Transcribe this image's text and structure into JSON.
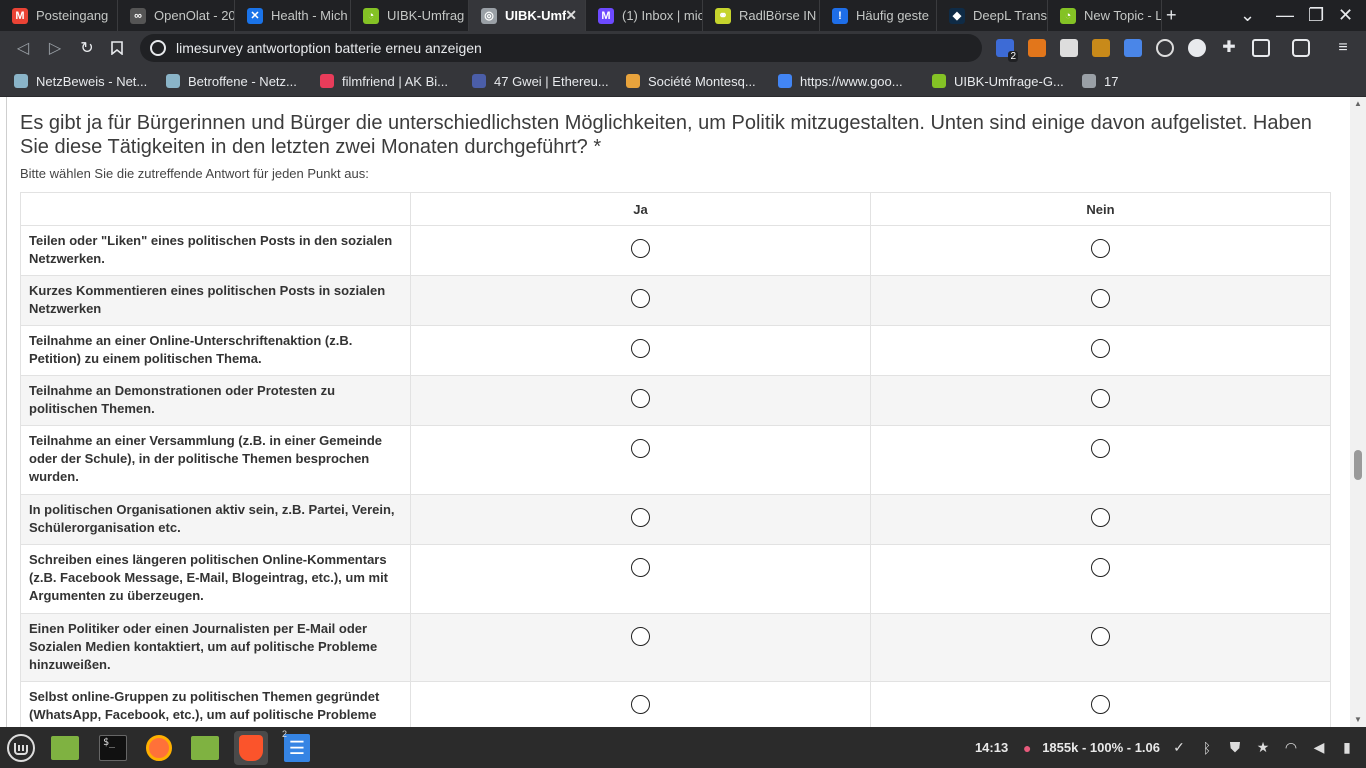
{
  "tabs": [
    {
      "label": "Posteingang",
      "icon": "gmail-icon",
      "color": "#ea4335",
      "glyph": "M"
    },
    {
      "label": "OpenOlat - 20",
      "icon": "openolat-icon",
      "color": "#555555",
      "glyph": "∞"
    },
    {
      "label": "Health - Mich",
      "icon": "health-icon",
      "color": "#1a73e8",
      "glyph": "✕"
    },
    {
      "label": "UIBK-Umfrag",
      "icon": "limesurvey-icon",
      "color": "#84c225",
      "glyph": "◔"
    },
    {
      "label": "UIBK-Umf",
      "icon": "globe-icon",
      "color": "#9aa0a6",
      "glyph": "◎",
      "active": true
    },
    {
      "label": "(1) Inbox | mic",
      "icon": "proton-mail-icon",
      "color": "#6d4aff",
      "glyph": "M"
    },
    {
      "label": "RadlBörse IN",
      "icon": "bike-icon",
      "color": "#c6d42d",
      "glyph": "⚭"
    },
    {
      "label": "Häufig geste",
      "icon": "faq-icon",
      "color": "#1e6ee8",
      "glyph": "!"
    },
    {
      "label": "DeepL Transl",
      "icon": "deepl-icon",
      "color": "#0f2b46",
      "glyph": "◆"
    },
    {
      "label": "New Topic - L",
      "icon": "limesurvey-icon",
      "color": "#84c225",
      "glyph": "◔"
    }
  ],
  "omnibox": {
    "text": "limesurvey antwortoption batterie erneu anzeigen"
  },
  "extensions": {
    "badge": "2"
  },
  "bookmarks": [
    {
      "label": "NetzBeweis - Net...",
      "icon": "netzbeweis-icon",
      "color": "#8ab4c8"
    },
    {
      "label": "Betroffene - Netz...",
      "icon": "netzbeweis-icon",
      "color": "#8ab4c8"
    },
    {
      "label": "filmfriend | AK Bi...",
      "icon": "filmfriend-icon",
      "color": "#e83c5a"
    },
    {
      "label": "47 Gwei | Ethereu...",
      "icon": "ethereum-icon",
      "color": "#4b5ea8"
    },
    {
      "label": "Société Montesq...",
      "icon": "montesquieu-icon",
      "color": "#e8a33c"
    },
    {
      "label": "https://www.goo...",
      "icon": "google-icon",
      "color": "#4285f4"
    },
    {
      "label": "UIBK-Umfrage-G...",
      "icon": "limesurvey-icon",
      "color": "#84c225"
    },
    {
      "label": "17",
      "icon": "globe-icon",
      "color": "#9aa0a6"
    }
  ],
  "question": {
    "text": "Es gibt ja für Bürgerinnen und Bürger die unterschiedlichsten Möglichkeiten, um Politik mitzugestalten. Unten sind einige davon aufgelistet. Haben Sie diese Tätigkeiten in den letzten zwei Monaten durchgeführt? *",
    "help": "Bitte wählen Sie die zutreffende Antwort für jeden Punkt aus:"
  },
  "grid": {
    "columns": [
      "Ja",
      "Nein"
    ],
    "rows": [
      "Teilen oder \"Liken\" eines politischen Posts in den sozialen Netzwerken.",
      "Kurzes Kommentieren eines politischen Posts in sozialen Netzwerken",
      "Teilnahme an einer Online-Unterschriftenaktion (z.B. Petition) zu einem politischen Thema.",
      "Teilnahme an Demonstrationen oder Protesten zu politischen Themen.",
      "Teilnahme an einer Versammlung (z.B. in einer Gemeinde oder der Schule), in der politische Themen besprochen wurden.",
      "In politischen Organisationen aktiv sein, z.B. Partei, Verein, Schülerorganisation etc.",
      "Schreiben eines längeren politischen Online-Kommentars (z.B. Facebook Message, E-Mail, Blogeintrag, etc.), um mit Argumenten zu überzeugen.",
      "Einen Politiker oder einen Journalisten per E-Mail oder Sozialen Medien kontaktiert, um auf politische Probleme hinzuweißen.",
      "Selbst online-Gruppen zu politischen Themen gegründet (WhatsApp, Facebook, etc.), um auf politische Probleme"
    ]
  },
  "taskbar": {
    "apps": [
      "mint-menu-icon",
      "files-icon",
      "terminal-icon",
      "firefox-icon",
      "folder-icon",
      "brave-icon",
      "text-editor-icon"
    ],
    "editor_badge": "2",
    "clock": "14:13",
    "weather": "1855k - 100% - 1.06"
  }
}
